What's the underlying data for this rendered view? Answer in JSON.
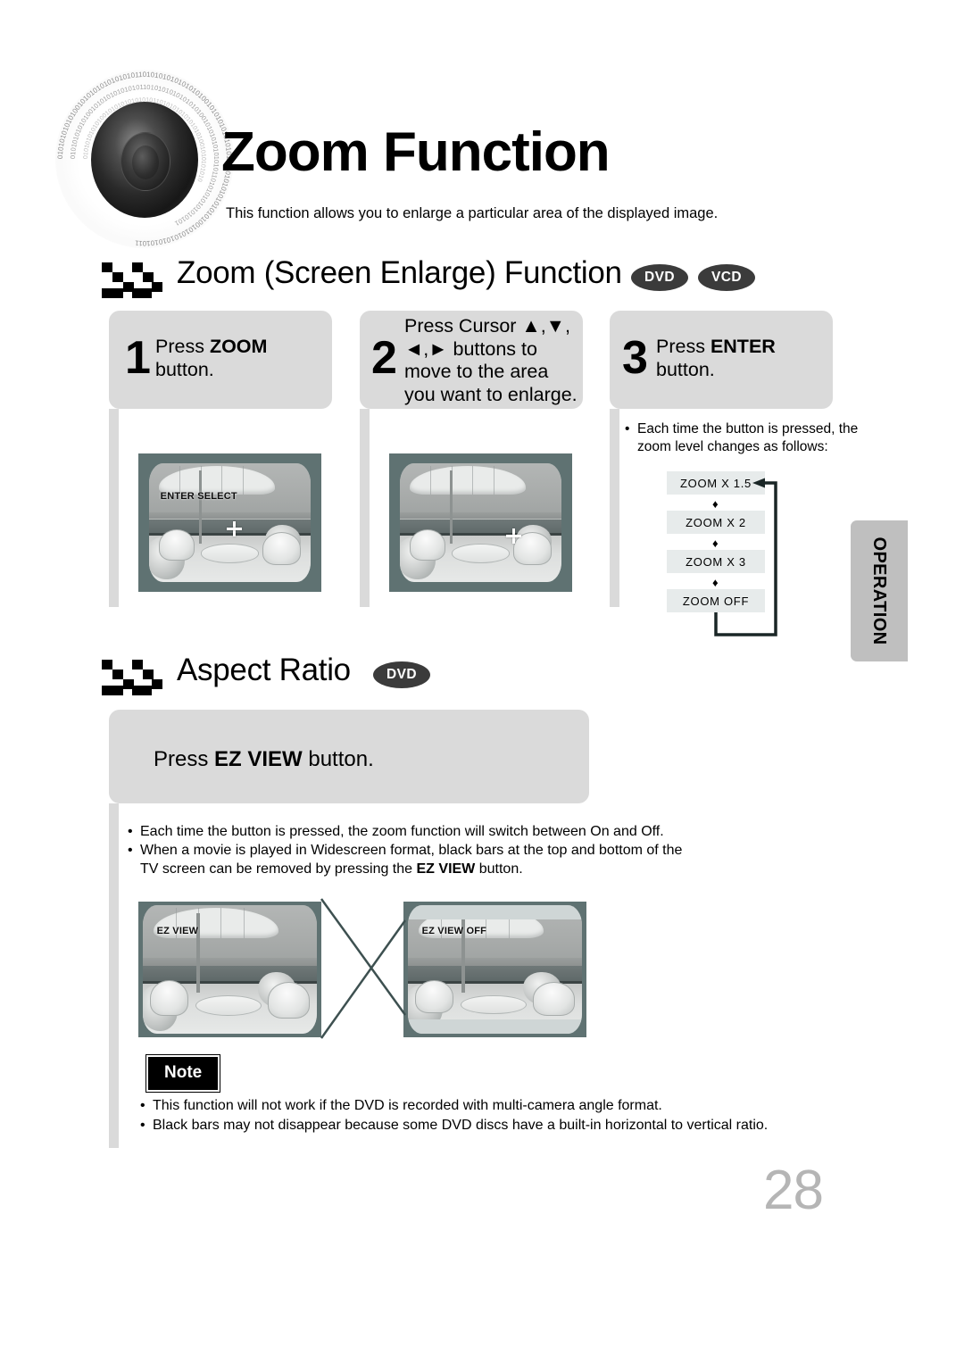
{
  "header": {
    "title": "Zoom Function",
    "subtitle": "This function allows you to enlarge a particular area of the displayed image.",
    "speaker_icon": "speaker-cone-icon",
    "binary_text": "010101010101010101010101"
  },
  "sections": [
    {
      "id": "zoom-screen-enlarge",
      "title": "Zoom (Screen Enlarge) Function",
      "flag_icon": "checkered-flag-icon",
      "badges": [
        "DVD",
        "VCD"
      ]
    },
    {
      "id": "aspect-ratio",
      "title": "Aspect Ratio",
      "flag_icon": "checkered-flag-icon",
      "badges": [
        "DVD"
      ]
    }
  ],
  "steps": [
    {
      "number": "1",
      "line1_prefix": "Press ",
      "line1_bold": "ZOOM",
      "line2": "button.",
      "screen": {
        "osd": "ENTER SELECT",
        "has_crosshair": true
      }
    },
    {
      "number": "2",
      "line1_prefix": "Press Cursor ",
      "line1_bold": "▲,▼,",
      "line2_bold": "◄,►",
      "line2_suffix": " buttons to",
      "line3": "move to the area",
      "line4": "you want to enlarge.",
      "screen": {
        "osd": "",
        "has_crosshair": true
      }
    },
    {
      "number": "3",
      "line1_prefix": "Press ",
      "line1_bold": "ENTER",
      "line2": "button."
    }
  ],
  "zoom_flow": {
    "note_line1": "Each time the button is pressed, the",
    "note_line2": "zoom level changes as follows:",
    "levels": [
      "ZOOM X 1.5",
      "ZOOM X 2",
      "ZOOM X 3",
      "ZOOM  OFF"
    ],
    "arrow_glyph": "♦",
    "loop_arrow": "loop-back-arrow-icon"
  },
  "operation_tab": {
    "label": "OPERATION"
  },
  "aspect": {
    "instruction_prefix": "Press ",
    "instruction_bold": "EZ VIEW",
    "instruction_suffix": " button.",
    "bullets": [
      {
        "parts": [
          {
            "text": "Each time the button is pressed, the zoom function will switch between On and Off.",
            "bold": false
          }
        ]
      },
      {
        "parts": [
          {
            "text": "When a movie is played in Widescreen format, black bars at the top and bottom of the",
            "bold": false
          }
        ]
      },
      {
        "indent": true,
        "parts": [
          {
            "text": "TV screen can be removed by pressing the ",
            "bold": false
          },
          {
            "text": "EZ VIEW",
            "bold": true
          },
          {
            "text": " button.",
            "bold": false
          }
        ]
      }
    ],
    "screens": [
      {
        "osd": "EZ VIEW",
        "letterboxed": false
      },
      {
        "osd": "EZ VIEW OFF",
        "letterboxed": true
      }
    ]
  },
  "note": {
    "label": "Note",
    "bullets": [
      "This function will not work if the DVD is recorded with multi-camera angle format.",
      "Black bars may not disappear because some DVD discs have a built-in horizontal to vertical ratio."
    ]
  },
  "page_number": "28",
  "colors": {
    "card_gray": "#dadada",
    "flow_box": "#e7ebeb",
    "tab_gray": "#bfbfbf",
    "badge_dark": "#3b3b3b",
    "tv_bezel": "#5f7272",
    "page_number": "#b5b5b5"
  }
}
